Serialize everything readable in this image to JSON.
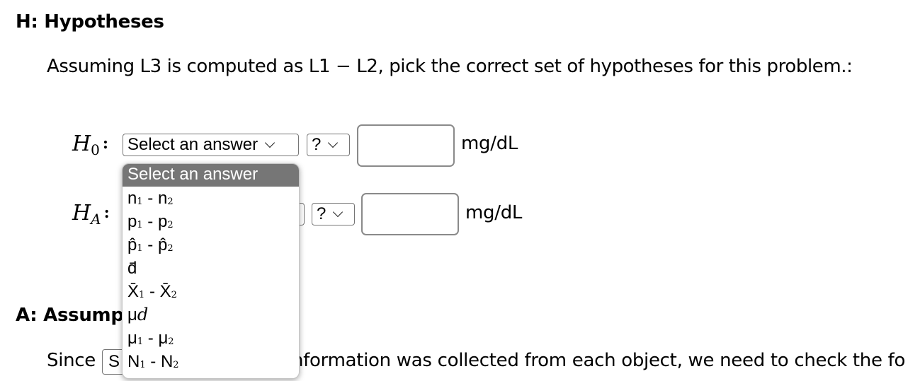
{
  "section_h": {
    "title": "H: Hypotheses"
  },
  "prompt": "Assuming L3 is computed as L1 − L2, pick the correct set of hypotheses for this problem.:",
  "h0": {
    "label_main": "H",
    "label_sub": "0",
    "colon": ":",
    "parameter_select": "Select an answer",
    "operator_select": "?",
    "value_input": "",
    "unit": "mg/dL"
  },
  "ha": {
    "label_main": "H",
    "label_sub": "A",
    "colon": ":",
    "operator_select": "?",
    "value_input": "",
    "unit": "mg/dL"
  },
  "dropdown": {
    "selected": "Select an answer",
    "options": [
      {
        "base1": "n",
        "sub1": "1",
        "sep": " - ",
        "base2": "n",
        "sub2": "2"
      },
      {
        "base1": "p",
        "sub1": "1",
        "sep": " - ",
        "base2": "p",
        "sub2": "2"
      },
      {
        "base1": "p̂",
        "sub1": "1",
        "sep": " - ",
        "base2": "p̂",
        "sub2": "2"
      },
      {
        "text": "d̄"
      },
      {
        "base1": "X̄",
        "sub1": "1",
        "sep": " - ",
        "base2": "X̄",
        "sub2": "2"
      },
      {
        "mu": "μ",
        "ital": "d"
      },
      {
        "base1": "μ",
        "sub1": "1",
        "sep": " - ",
        "base2": "μ",
        "sub2": "2"
      },
      {
        "base1": "N",
        "sub1": "1",
        "sep": " - ",
        "base2": "N",
        "sub2": "2"
      }
    ]
  },
  "section_a": {
    "title": "A: Assumpt"
  },
  "since": {
    "lead": "Since",
    "select_value": "S",
    "rest": "nformation was collected from each object, we need to check the fo"
  }
}
